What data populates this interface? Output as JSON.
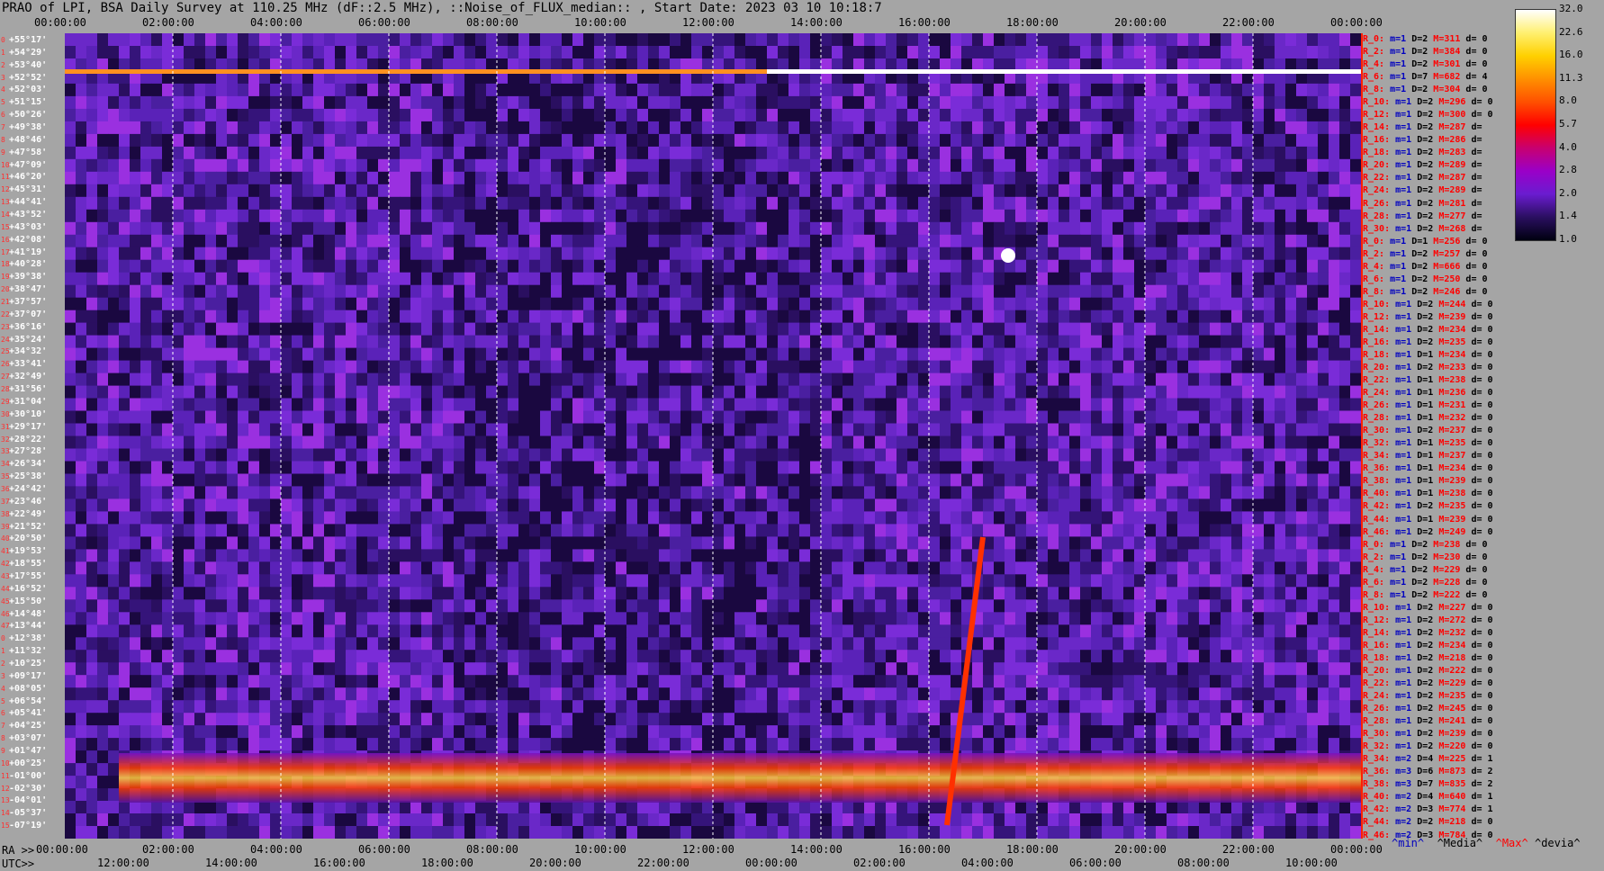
{
  "title": "PRAO of LPI, BSA Daily Survey at 110.25 MHz (dF::2.5 MHz), ::Noise_of_FLUX_median:: , Start Date: 2023 03 10 10:18:7",
  "chart_data": {
    "type": "heatmap",
    "title": "PRAO of LPI, BSA Daily Survey at 110.25 MHz (dF::2.5 MHz), ::Noise_of_FLUX_median:: , Start Date: 2023 03 10 10:18:7",
    "x_top_ticks": [
      "00:00:00",
      "02:00:00",
      "04:00:00",
      "06:00:00",
      "08:00:00",
      "10:00:00",
      "12:00:00",
      "14:00:00",
      "16:00:00",
      "18:00:00",
      "20:00:00",
      "22:00:00",
      "00:00:00"
    ],
    "x_bottom_ra_ticks": [
      "00:00:00",
      "02:00:00",
      "04:00:00",
      "06:00:00",
      "08:00:00",
      "10:00:00",
      "12:00:00",
      "14:00:00",
      "16:00:00",
      "18:00:00",
      "20:00:00",
      "22:00:00",
      "00:00:00"
    ],
    "x_bottom_utc_ticks": [
      "12:00:00",
      "14:00:00",
      "16:00:00",
      "18:00:00",
      "20:00:00",
      "22:00:00",
      "00:00:00",
      "02:00:00",
      "04:00:00",
      "06:00:00",
      "08:00:00",
      "10:00:00"
    ],
    "ra_prefix": "RA >>",
    "utc_prefix": "UTC>>",
    "y_ticks": [
      "+55°17'",
      "+54°29'",
      "+53°40'",
      "+52°52'",
      "+52°03'",
      "+51°15'",
      "+50°26'",
      "+49°38'",
      "+48°46'",
      "+47°58'",
      "+47°09'",
      "+46°20'",
      "+45°31'",
      "+44°41'",
      "+43°52'",
      "+43°03'",
      "+42°08'",
      "+41°19'",
      "+40°28'",
      "+39°38'",
      "+38°47'",
      "+37°57'",
      "+37°07'",
      "+36°16'",
      "+35°24'",
      "+34°32'",
      "+33°41'",
      "+32°49'",
      "+31°56'",
      "+31°04'",
      "+30°10'",
      "+29°17'",
      "+28°22'",
      "+27°28'",
      "+26°34'",
      "+25°38'",
      "+24°42'",
      "+23°46'",
      "+22°49'",
      "+21°52'",
      "+20°50'",
      "+19°53'",
      "+18°55'",
      "+17°55'",
      "+16°52'",
      "+15°50'",
      "+14°48'",
      "+13°44'",
      "+12°38'",
      "+11°32'",
      "+10°25'",
      "+09°17'",
      "+08°05'",
      "+06°54'",
      "+05°41'",
      "+04°25'",
      "+03°07'",
      "+01°47'",
      "+00°25'",
      "-01°00'",
      "-02°30'",
      "-04°01'",
      "-05°37'",
      "-07°19'"
    ],
    "colorbar_ticks": [
      "32.0",
      "22.6",
      "16.0",
      "11.3",
      "8.0",
      "5.7",
      "4.0",
      "2.8",
      "2.0",
      "1.4",
      "1.0"
    ],
    "colorbar_colors": [
      "#ffffff",
      "#fff070",
      "#ffd000",
      "#ff9000",
      "#ff5000",
      "#ff0000",
      "#c80070",
      "#9a00c8",
      "#6a1cd0",
      "#2a0f60",
      "#000010"
    ],
    "stats": [
      {
        "r": "R_0:",
        "m": "m=1",
        "D": "D=2",
        "M": "M=311",
        "d": "d= 0"
      },
      {
        "r": "R_2:",
        "m": "m=1",
        "D": "D=2",
        "M": "M=384",
        "d": "d= 0"
      },
      {
        "r": "R_4:",
        "m": "m=1",
        "D": "D=2",
        "M": "M=301",
        "d": "d= 0"
      },
      {
        "r": "R_6:",
        "m": "m=1",
        "D": "D=7",
        "M": "M=682",
        "d": "d= 4"
      },
      {
        "r": "R_8:",
        "m": "m=1",
        "D": "D=2",
        "M": "M=304",
        "d": "d= 0"
      },
      {
        "r": "R_10:",
        "m": "m=1",
        "D": "D=2",
        "M": "M=296",
        "d": "d= 0"
      },
      {
        "r": "R_12:",
        "m": "m=1",
        "D": "D=2",
        "M": "M=300",
        "d": "d= 0"
      },
      {
        "r": "R_14:",
        "m": "m=1",
        "D": "D=2",
        "M": "M=287",
        "d": "d="
      },
      {
        "r": "R_16:",
        "m": "m=1",
        "D": "D=2",
        "M": "M=286",
        "d": "d="
      },
      {
        "r": "R_18:",
        "m": "m=1",
        "D": "D=2",
        "M": "M=283",
        "d": "d="
      },
      {
        "r": "R_20:",
        "m": "m=1",
        "D": "D=2",
        "M": "M=289",
        "d": "d="
      },
      {
        "r": "R_22:",
        "m": "m=1",
        "D": "D=2",
        "M": "M=287",
        "d": "d="
      },
      {
        "r": "R_24:",
        "m": "m=1",
        "D": "D=2",
        "M": "M=289",
        "d": "d="
      },
      {
        "r": "R_26:",
        "m": "m=1",
        "D": "D=2",
        "M": "M=281",
        "d": "d="
      },
      {
        "r": "R_28:",
        "m": "m=1",
        "D": "D=2",
        "M": "M=277",
        "d": "d="
      },
      {
        "r": "R_30:",
        "m": "m=1",
        "D": "D=2",
        "M": "M=268",
        "d": "d="
      },
      {
        "r": "R_0:",
        "m": "m=1",
        "D": "D=1",
        "M": "M=256",
        "d": "d= 0"
      },
      {
        "r": "R_2:",
        "m": "m=1",
        "D": "D=2",
        "M": "M=257",
        "d": "d= 0"
      },
      {
        "r": "R_4:",
        "m": "m=1",
        "D": "D=2",
        "M": "M=666",
        "d": "d= 0"
      },
      {
        "r": "R_6:",
        "m": "m=1",
        "D": "D=2",
        "M": "M=250",
        "d": "d= 0"
      },
      {
        "r": "R_8:",
        "m": "m=1",
        "D": "D=2",
        "M": "M=246",
        "d": "d= 0"
      },
      {
        "r": "R_10:",
        "m": "m=1",
        "D": "D=2",
        "M": "M=244",
        "d": "d= 0"
      },
      {
        "r": "R_12:",
        "m": "m=1",
        "D": "D=2",
        "M": "M=239",
        "d": "d= 0"
      },
      {
        "r": "R_14:",
        "m": "m=1",
        "D": "D=2",
        "M": "M=234",
        "d": "d= 0"
      },
      {
        "r": "R_16:",
        "m": "m=1",
        "D": "D=2",
        "M": "M=235",
        "d": "d= 0"
      },
      {
        "r": "R_18:",
        "m": "m=1",
        "D": "D=1",
        "M": "M=234",
        "d": "d= 0"
      },
      {
        "r": "R_20:",
        "m": "m=1",
        "D": "D=2",
        "M": "M=233",
        "d": "d= 0"
      },
      {
        "r": "R_22:",
        "m": "m=1",
        "D": "D=1",
        "M": "M=238",
        "d": "d= 0"
      },
      {
        "r": "R_24:",
        "m": "m=1",
        "D": "D=1",
        "M": "M=236",
        "d": "d= 0"
      },
      {
        "r": "R_26:",
        "m": "m=1",
        "D": "D=1",
        "M": "M=231",
        "d": "d= 0"
      },
      {
        "r": "R_28:",
        "m": "m=1",
        "D": "D=1",
        "M": "M=232",
        "d": "d= 0"
      },
      {
        "r": "R_30:",
        "m": "m=1",
        "D": "D=2",
        "M": "M=237",
        "d": "d= 0"
      },
      {
        "r": "R_32:",
        "m": "m=1",
        "D": "D=1",
        "M": "M=235",
        "d": "d= 0"
      },
      {
        "r": "R_34:",
        "m": "m=1",
        "D": "D=1",
        "M": "M=237",
        "d": "d= 0"
      },
      {
        "r": "R_36:",
        "m": "m=1",
        "D": "D=1",
        "M": "M=234",
        "d": "d= 0"
      },
      {
        "r": "R_38:",
        "m": "m=1",
        "D": "D=1",
        "M": "M=239",
        "d": "d= 0"
      },
      {
        "r": "R_40:",
        "m": "m=1",
        "D": "D=1",
        "M": "M=238",
        "d": "d= 0"
      },
      {
        "r": "R_42:",
        "m": "m=1",
        "D": "D=2",
        "M": "M=235",
        "d": "d= 0"
      },
      {
        "r": "R_44:",
        "m": "m=1",
        "D": "D=1",
        "M": "M=239",
        "d": "d= 0"
      },
      {
        "r": "R_46:",
        "m": "m=1",
        "D": "D=2",
        "M": "M=249",
        "d": "d= 0"
      },
      {
        "r": "R_0:",
        "m": "m=1",
        "D": "D=2",
        "M": "M=238",
        "d": "d= 0"
      },
      {
        "r": "R_2:",
        "m": "m=1",
        "D": "D=2",
        "M": "M=230",
        "d": "d= 0"
      },
      {
        "r": "R_4:",
        "m": "m=1",
        "D": "D=2",
        "M": "M=229",
        "d": "d= 0"
      },
      {
        "r": "R_6:",
        "m": "m=1",
        "D": "D=2",
        "M": "M=228",
        "d": "d= 0"
      },
      {
        "r": "R_8:",
        "m": "m=1",
        "D": "D=2",
        "M": "M=222",
        "d": "d= 0"
      },
      {
        "r": "R_10:",
        "m": "m=1",
        "D": "D=2",
        "M": "M=227",
        "d": "d= 0"
      },
      {
        "r": "R_12:",
        "m": "m=1",
        "D": "D=2",
        "M": "M=272",
        "d": "d= 0"
      },
      {
        "r": "R_14:",
        "m": "m=1",
        "D": "D=2",
        "M": "M=232",
        "d": "d= 0"
      },
      {
        "r": "R_16:",
        "m": "m=1",
        "D": "D=2",
        "M": "M=234",
        "d": "d= 0"
      },
      {
        "r": "R_18:",
        "m": "m=1",
        "D": "D=2",
        "M": "M=218",
        "d": "d= 0"
      },
      {
        "r": "R_20:",
        "m": "m=1",
        "D": "D=2",
        "M": "M=222",
        "d": "d= 0"
      },
      {
        "r": "R_22:",
        "m": "m=1",
        "D": "D=2",
        "M": "M=229",
        "d": "d= 0"
      },
      {
        "r": "R_24:",
        "m": "m=1",
        "D": "D=2",
        "M": "M=235",
        "d": "d= 0"
      },
      {
        "r": "R_26:",
        "m": "m=1",
        "D": "D=2",
        "M": "M=245",
        "d": "d= 0"
      },
      {
        "r": "R_28:",
        "m": "m=1",
        "D": "D=2",
        "M": "M=241",
        "d": "d= 0"
      },
      {
        "r": "R_30:",
        "m": "m=1",
        "D": "D=2",
        "M": "M=239",
        "d": "d= 0"
      },
      {
        "r": "R_32:",
        "m": "m=1",
        "D": "D=2",
        "M": "M=220",
        "d": "d= 0"
      },
      {
        "r": "R_34:",
        "m": "m=2",
        "D": "D=4",
        "M": "M=225",
        "d": "d= 1"
      },
      {
        "r": "R_36:",
        "m": "m=3",
        "D": "D=6",
        "M": "M=873",
        "d": "d= 2"
      },
      {
        "r": "R_38:",
        "m": "m=3",
        "D": "D=7",
        "M": "M=835",
        "d": "d= 2"
      },
      {
        "r": "R_40:",
        "m": "m=2",
        "D": "D=4",
        "M": "M=640",
        "d": "d= 1"
      },
      {
        "r": "R_42:",
        "m": "m=2",
        "D": "D=3",
        "M": "M=774",
        "d": "d= 1"
      },
      {
        "r": "R_44:",
        "m": "m=2",
        "D": "D=2",
        "M": "M=218",
        "d": "d= 0"
      },
      {
        "r": "R_46:",
        "m": "m=2",
        "D": "D=3",
        "M": "M=784",
        "d": "d= 0"
      }
    ],
    "footer": {
      "min": "^min^",
      "median": "^Media^",
      "max": "^Max^",
      "dev": "^devia^"
    },
    "grid": true
  }
}
